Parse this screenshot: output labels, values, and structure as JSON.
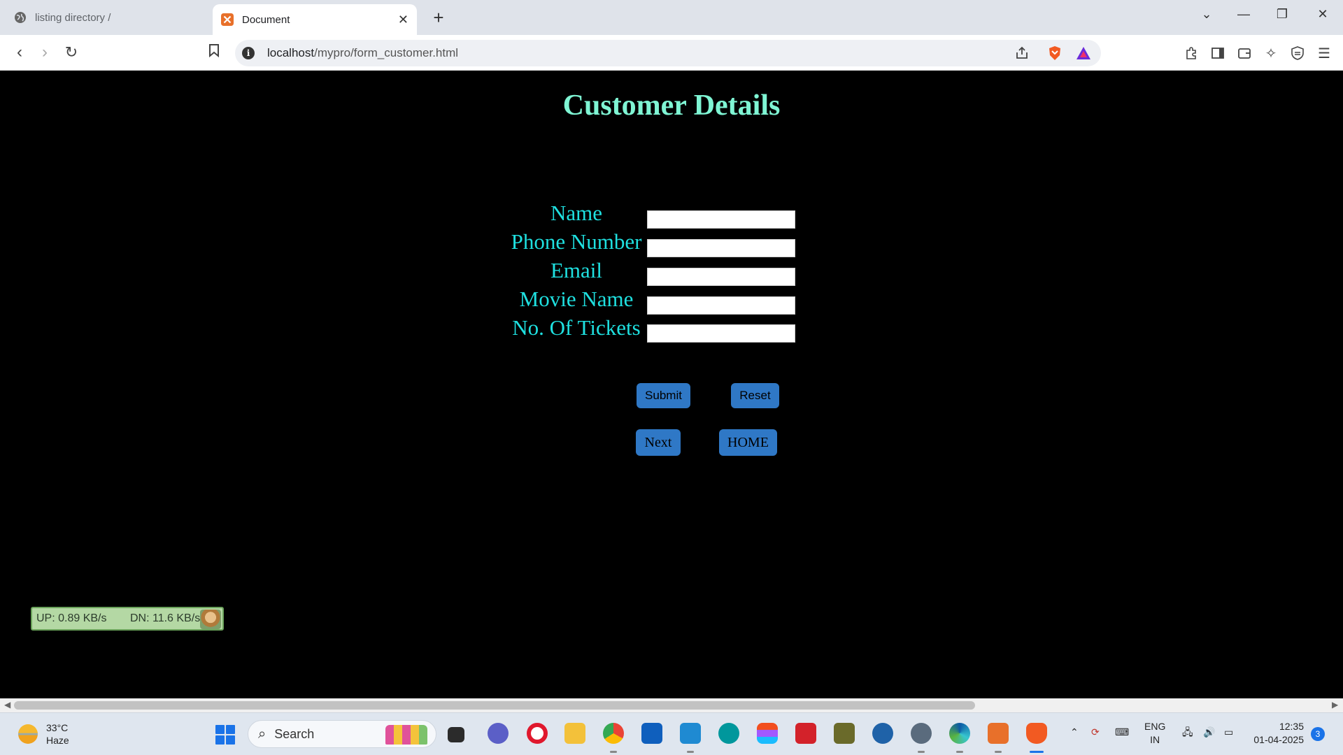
{
  "browser": {
    "tabs": [
      {
        "label": "listing directory /",
        "active": false
      },
      {
        "label": "Document",
        "active": true
      }
    ],
    "url_host": "localhost",
    "url_path": "/mypro/form_customer.html"
  },
  "page": {
    "title": "Customer Details",
    "form": {
      "fields": [
        {
          "label": "Name",
          "value": ""
        },
        {
          "label": "Phone Number",
          "value": ""
        },
        {
          "label": "Email",
          "value": ""
        },
        {
          "label": "Movie Name",
          "value": ""
        },
        {
          "label": "No. Of Tickets",
          "value": ""
        }
      ],
      "submit_label": "Submit",
      "reset_label": "Reset",
      "next_label": "Next",
      "home_label": "HOME"
    },
    "colors": {
      "title": "#7ff5d4",
      "labels": "#1fe0e0",
      "buttons": "#2f78c6",
      "background": "#000000"
    }
  },
  "netmeter": {
    "up": "UP: 0.89 KB/s",
    "down": "DN: 11.6 KB/s"
  },
  "taskbar": {
    "weather_temp": "33°C",
    "weather_desc": "Haze",
    "search_label": "Search",
    "lang_primary": "ENG",
    "lang_secondary": "IN",
    "time": "12:35",
    "date": "01-04-2025",
    "notification_count": "3"
  }
}
